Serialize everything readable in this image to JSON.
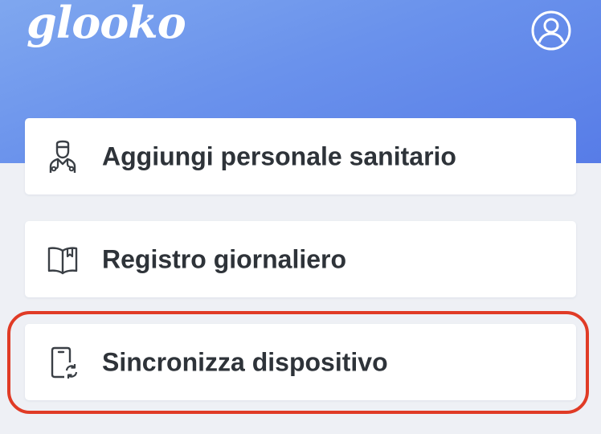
{
  "header": {
    "logo_text": "glooko",
    "profile_icon": "user-circle-icon",
    "background_color_start": "#7fa7ef",
    "background_color_end": "#577ce7"
  },
  "menu": {
    "items": [
      {
        "label": "Aggiungi personale sanitario",
        "icon": "doctor-icon"
      },
      {
        "label": "Registro giornaliero",
        "icon": "book-icon"
      },
      {
        "label": "Sincronizza dispositivo",
        "icon": "phone-sync-icon"
      }
    ]
  },
  "highlight": {
    "target": "Sincronizza dispositivo",
    "color": "#e03b26"
  }
}
